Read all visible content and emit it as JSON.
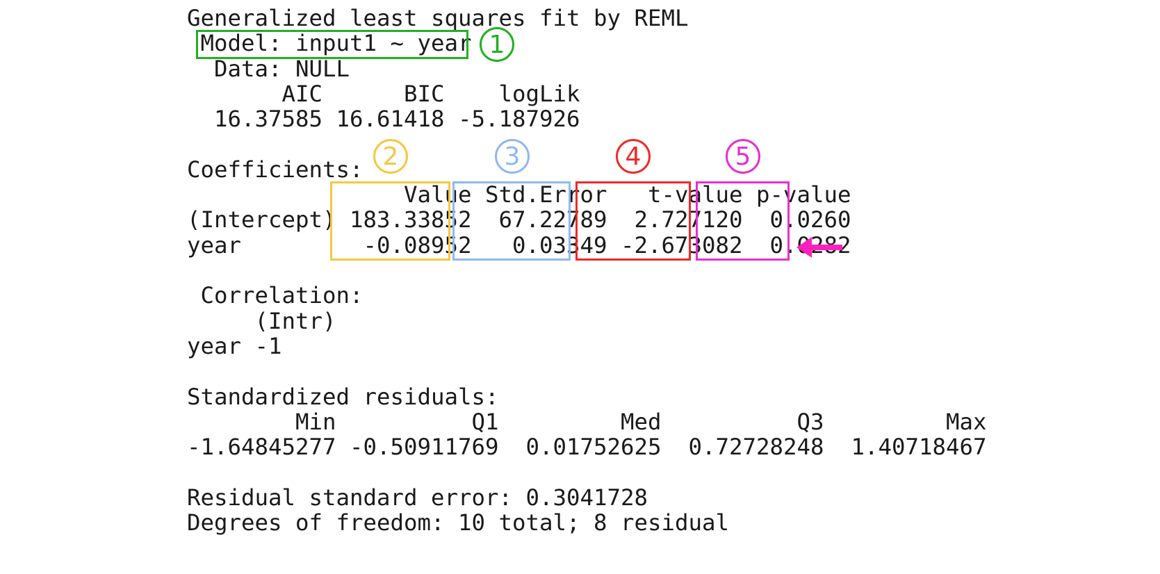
{
  "output": {
    "title": "Generalized least squares fit by REML",
    "model_line": " Model: input1 ~ year ",
    "data_line": "  Data: NULL",
    "fit_header": "       AIC      BIC    logLik",
    "fit_values": "  16.37585 16.61418 -5.187926",
    "coef_title": "Coefficients:",
    "coef_row_header": "                Value Std.Error   t-value p-value",
    "coef_row_intercept": "(Intercept) 183.33852  67.22789  2.727120  0.0260",
    "coef_row_year": "year         -0.08952   0.03349 -2.673082  0.0282",
    "corr_title": " Correlation:",
    "corr_header": "     (Intr)",
    "corr_row": "year -1",
    "resid_title": "Standardized residuals:",
    "resid_header": "        Min          Q1         Med          Q3         Max",
    "resid_values": "-1.64845277 -0.50911769  0.01752625  0.72728248  1.40718467",
    "rse_line": "Residual standard error: 0.3041728",
    "df_line": "Degrees of freedom: 10 total; 8 residual"
  },
  "annotations": {
    "markers": [
      "①",
      "②",
      "③",
      "④",
      "⑤"
    ],
    "plain_numbers": [
      "1",
      "2",
      "3",
      "4",
      "5"
    ],
    "colors": {
      "model": "#22b022",
      "value": "#f5c842",
      "std_error": "#8fb8f0",
      "t_value": "#ee2a2a",
      "p_value": "#e62fd0",
      "arrow": "#ff1fbf"
    },
    "arrow_icon": "left-arrow-icon"
  }
}
